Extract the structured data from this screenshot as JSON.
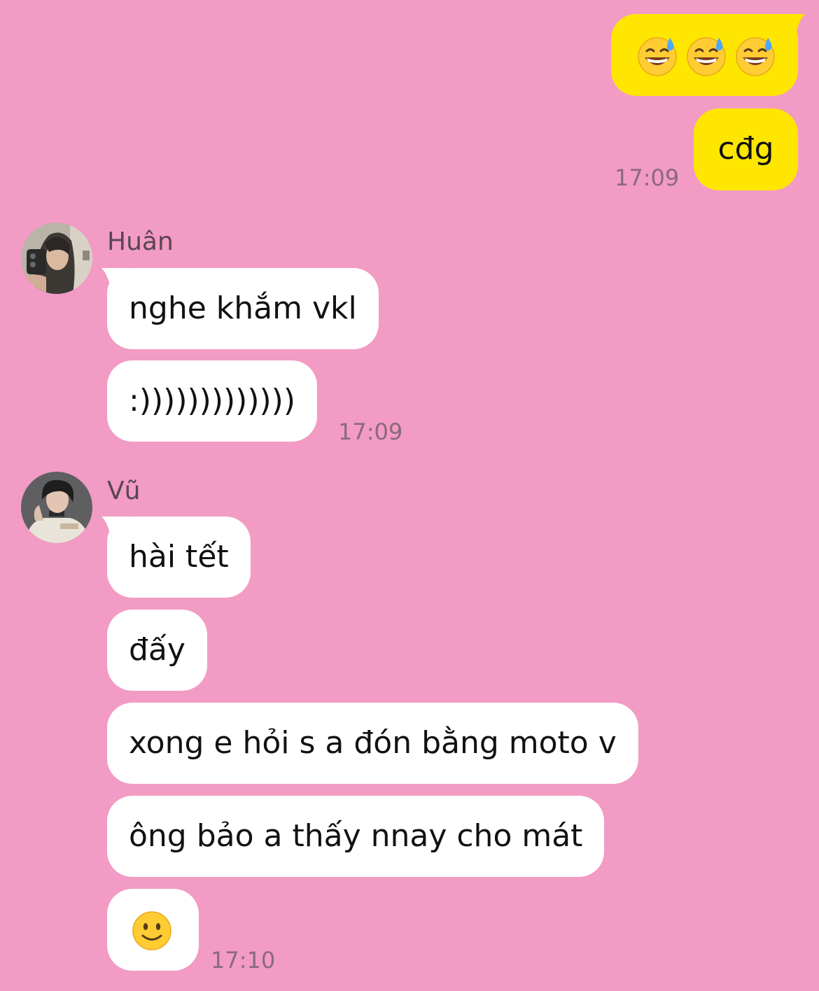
{
  "colors": {
    "background": "#f29bc4",
    "outgoing_bubble": "#ffe600",
    "incoming_bubble": "#ffffff",
    "timestamp": "#8a6a7a"
  },
  "outgoing": {
    "messages": [
      {
        "type": "emoji",
        "icons": [
          "grinning-sweat-emoji",
          "grinning-sweat-emoji",
          "grinning-sweat-emoji"
        ]
      },
      {
        "type": "text",
        "text": "cđg"
      }
    ],
    "time": "17:09"
  },
  "groups": [
    {
      "sender": "Huân",
      "avatar_icon": "avatar-photo",
      "messages": [
        "nghe khắm vkl",
        ":)))))))))))))"
      ],
      "time": "17:09"
    },
    {
      "sender": "Vũ",
      "avatar_icon": "avatar-photo",
      "messages": [
        "hài tết",
        "đấy",
        "xong e hỏi s a đón bằng moto v",
        "ông bảo a thấy nnay cho mát"
      ],
      "last_message": {
        "type": "emoji",
        "icon": "slightly-smiling-face-emoji"
      },
      "time": "17:10"
    }
  ]
}
